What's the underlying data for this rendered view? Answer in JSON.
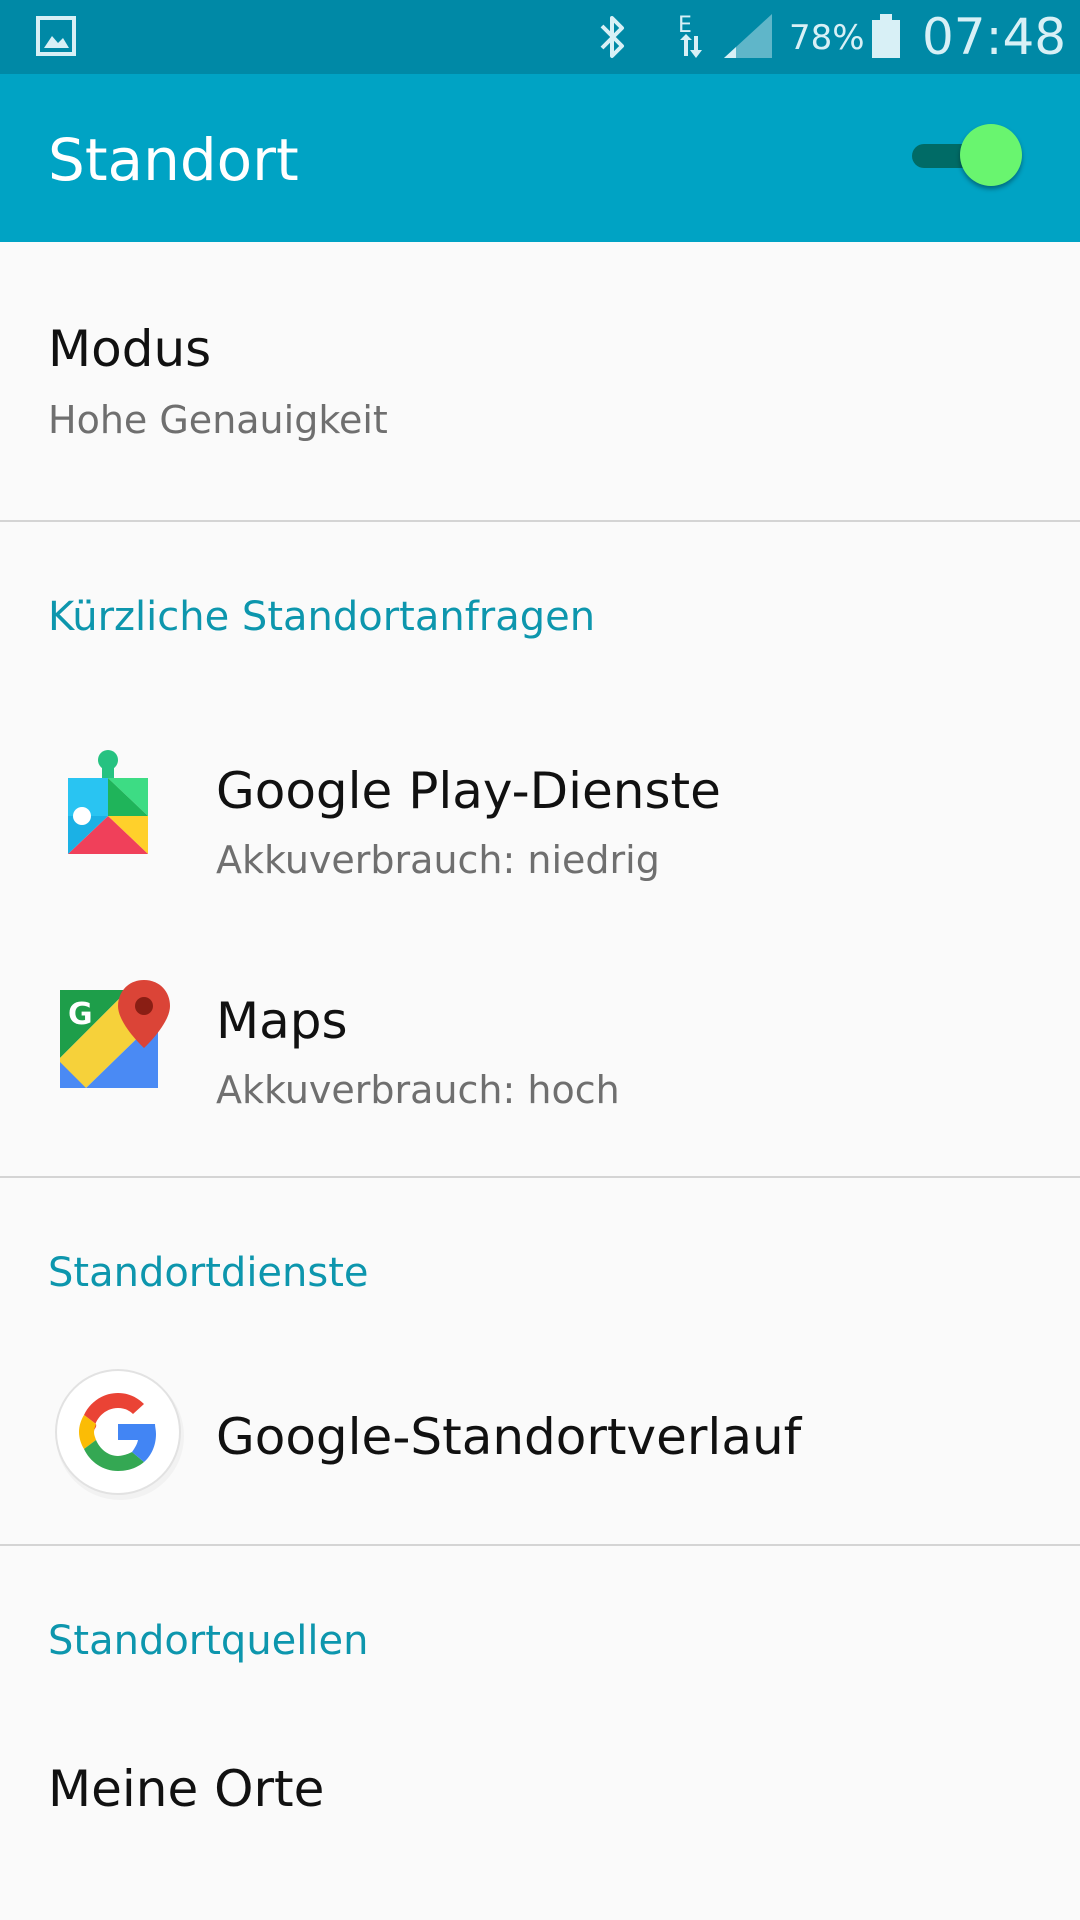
{
  "status_bar": {
    "battery_percent": "78%",
    "time": "07:48",
    "network_type": "E",
    "icons": [
      "gallery-icon",
      "bluetooth-icon",
      "network-icon",
      "signal-icon",
      "battery-icon"
    ]
  },
  "app_bar": {
    "title": "Standort",
    "location_toggle_on": true
  },
  "mode": {
    "title": "Modus",
    "value": "Hohe Genauigkeit"
  },
  "recent_requests": {
    "header": "Kürzliche Standortanfragen",
    "items": [
      {
        "name": "Google Play-Dienste",
        "battery": "Akkuverbrauch: niedrig",
        "icon": "google-play-services-icon"
      },
      {
        "name": "Maps",
        "battery": "Akkuverbrauch: hoch",
        "icon": "google-maps-icon"
      }
    ]
  },
  "location_services": {
    "header": "Standortdienste",
    "items": [
      {
        "name": "Google-Standortverlauf",
        "icon": "google-icon"
      }
    ]
  },
  "location_sources": {
    "header": "Standortquellen",
    "items": [
      {
        "name": "Meine Orte"
      }
    ]
  },
  "colors": {
    "status_bar": "#0089a6",
    "app_bar": "#00a3c4",
    "accent_header": "#0d96ad",
    "toggle_thumb": "#69f56f",
    "background": "#fafafa"
  }
}
